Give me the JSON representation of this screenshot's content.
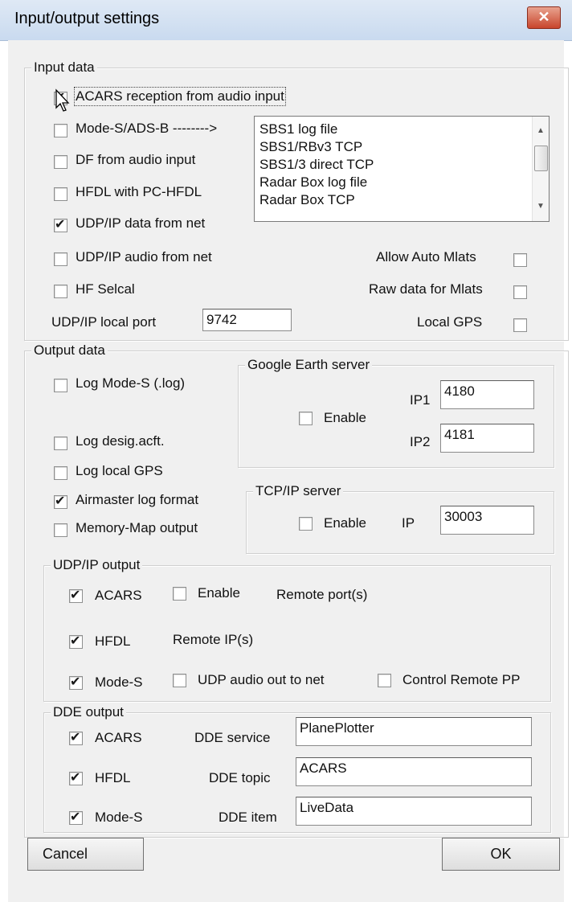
{
  "window": {
    "title": "Input/output settings",
    "close_glyph": "✕"
  },
  "input": {
    "legend": "Input data",
    "acars_audio": {
      "label": "ACARS reception from audio input",
      "checked": true
    },
    "modes_adsb": {
      "label": "Mode-S/ADS-B -------->",
      "checked": false
    },
    "df_audio": {
      "label": "DF from audio input",
      "checked": false
    },
    "hfdl_pc": {
      "label": "HFDL with PC-HFDL",
      "checked": false
    },
    "udp_data": {
      "label": "UDP/IP data from net",
      "checked": true
    },
    "udp_audio": {
      "label": "UDP/IP audio from net",
      "checked": false
    },
    "hf_selcal": {
      "label": "HF Selcal",
      "checked": false
    },
    "allow_auto_mlats": {
      "label": "Allow Auto Mlats",
      "checked": false
    },
    "raw_data_mlats": {
      "label": "Raw data for Mlats",
      "checked": false
    },
    "local_gps": {
      "label": "Local GPS",
      "checked": false
    },
    "local_port_label": "UDP/IP local port",
    "local_port_value": "9742",
    "source_list": [
      "SBS1 log file",
      "SBS1/RBv3 TCP",
      "SBS1/3 direct TCP",
      "Radar Box log file",
      "Radar Box TCP"
    ]
  },
  "output": {
    "legend": "Output data",
    "log_modes": {
      "label": "Log Mode-S (.log)",
      "checked": false
    },
    "log_desig": {
      "label": "Log desig.acft.",
      "checked": false
    },
    "log_gps": {
      "label": "Log local GPS",
      "checked": false
    },
    "airmaster": {
      "label": "Airmaster log format",
      "checked": true
    },
    "memory_map": {
      "label": "Memory-Map output",
      "checked": false
    },
    "google_earth": {
      "legend": "Google Earth server",
      "enable_label": "Enable",
      "enable_checked": false,
      "ip1_label": "IP1",
      "ip1_value": "4180",
      "ip2_label": "IP2",
      "ip2_value": "4181"
    },
    "tcp_server": {
      "legend": "TCP/IP server",
      "enable_label": "Enable",
      "enable_checked": false,
      "ip_label": "IP",
      "ip_value": "30003"
    },
    "udp_output": {
      "legend": "UDP/IP output",
      "acars": {
        "label": "ACARS",
        "checked": true
      },
      "hfdl": {
        "label": "HFDL",
        "checked": true
      },
      "modes": {
        "label": "Mode-S",
        "checked": true
      },
      "enable": {
        "label": "Enable",
        "checked": false
      },
      "remote_ports_label": "Remote port(s)",
      "remote_ips_label": "Remote IP(s)",
      "udp_audio_out": {
        "label": "UDP audio out to net",
        "checked": false
      },
      "control_remote_pp": {
        "label": "Control Remote PP",
        "checked": false
      }
    },
    "dde_output": {
      "legend": "DDE output",
      "acars": {
        "label": "ACARS",
        "checked": true
      },
      "hfdl": {
        "label": "HFDL",
        "checked": true
      },
      "modes": {
        "label": "Mode-S",
        "checked": true
      },
      "service_label": "DDE service",
      "service_value": "PlanePlotter",
      "topic_label": "DDE topic",
      "topic_value": "ACARS",
      "item_label": "DDE item",
      "item_value": "LiveData"
    }
  },
  "buttons": {
    "cancel": "Cancel",
    "ok": "OK"
  }
}
